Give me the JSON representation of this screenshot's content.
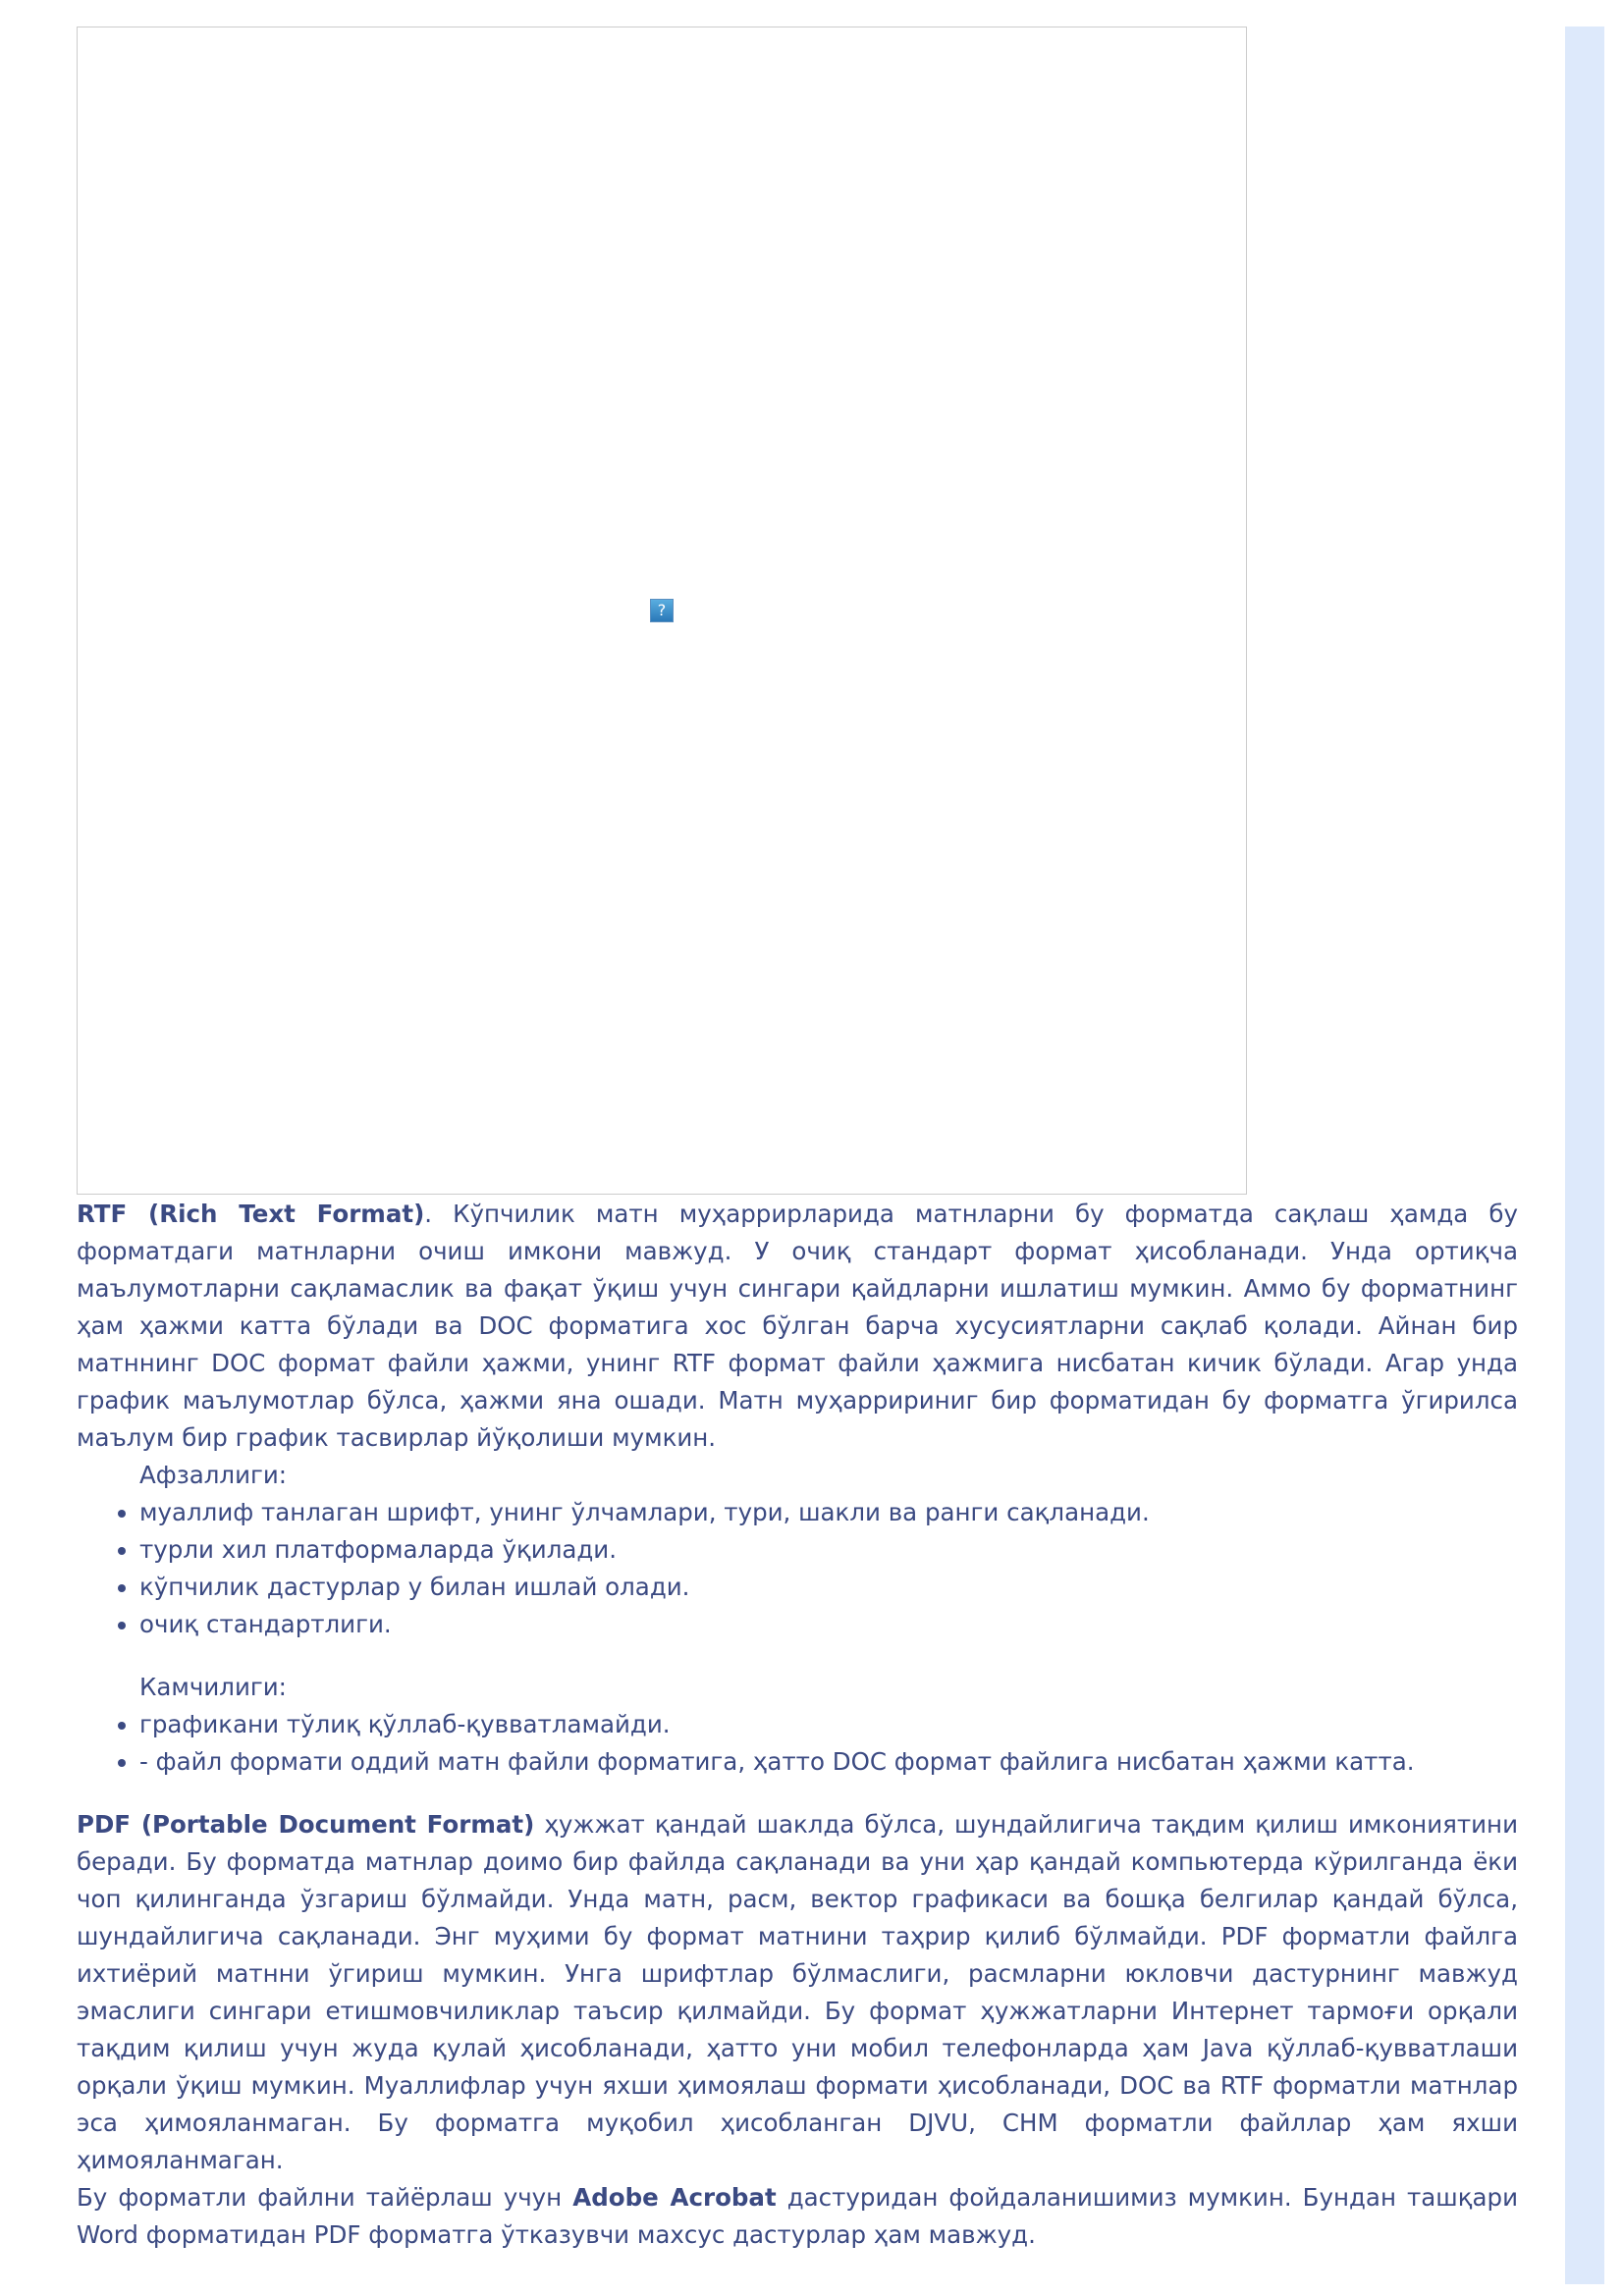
{
  "image": {
    "broken_icon_glyph": "?"
  },
  "rtf": {
    "term": "RTF (Rich Text Format)",
    "text": ". Кўпчилик матн муҳаррирларида матнларни бу форматда сақлаш ҳамда бу форматдаги матнларни очиш имкони мавжуд. У очиқ стандарт формат ҳисобланади. Унда ортиқча маълумотларни сақламаслик ва фақат ўқиш учун сингари қайдларни ишлатиш мумкин. Аммо бу форматнинг ҳам ҳажми катта бўлади ва DOC форматига хос бўлган барча хусусиятларни сақлаб қолади. Айнан бир матннинг DOC формат файли ҳажми, унинг RTF формат файли ҳажмига нисбатан кичик бўлади. Агар унда график маълумотлар бўлса, ҳажми яна ошади. Матн муҳарририниг бир форматидан бу форматга ўгирилса маълум бир график тасвирлар йўқолиши мумкин.",
    "advantages_label": "Афзаллиги:",
    "advantages": [
      "муаллиф танлаган шрифт, унинг ўлчамлари, тури, шакли ва ранги сақланади.",
      "турли хил платформаларда ўқилади.",
      "кўпчилик дастурлар у билан ишлай олади.",
      "очиқ стандартлиги."
    ],
    "disadvantages_label": "Камчилиги:",
    "disadvantages": [
      "графикани тўлиқ қўллаб-қувватламайди.",
      "- файл формати оддий матн файли форматига, ҳатто DOC формат файлига нисбатан ҳажми катта."
    ]
  },
  "pdf": {
    "term": "PDF (Portable Document Format)",
    "text": " ҳужжат қандай шаклда бўлса, шундайлигича тақдим қилиш имкониятини беради. Бу форматда матнлар доимо бир файлда сақланади ва уни ҳар қандай компьютерда кўрилганда ёки чоп қилинганда ўзгариш бўлмайди. Унда матн, расм, вектор графикаси ва бошқа белгилар қандай бўлса, шундайлигича сақланади. Энг муҳими бу формат матнини таҳрир қилиб бўлмайди. PDF форматли файлга ихтиёрий матнни ўгириш мумкин. Унга шрифтлар бўлмаслиги, расмларни юкловчи дастурнинг мавжуд эмаслиги сингари етишмовчиликлар таъсир қилмайди. Бу формат ҳужжатларни Интернет тармоғи орқали тақдим қилиш учун жуда қулай ҳисобланади, ҳатто уни мобил телефонларда ҳам Java қўллаб-қувватлаши орқали ўқиш мумкин. Муаллифлар учун яхши ҳимоялаш формати ҳисобланади, DOC ва RTF форматли матнлар эса ҳимояланмаган. Бу форматга муқобил ҳисобланган DJVU, CHM форматли файллар ҳам яхши ҳимояланмаган.",
    "acrobat_before": "Бу форматли файлни тайёрлаш учун ",
    "acrobat_term": "Adobe Acrobat",
    "acrobat_after": " дастуридан фойдаланишимиз мумкин. Бундан ташқари Word форматидан PDF форматга ўтказувчи махсус дастурлар ҳам мавжуд."
  }
}
